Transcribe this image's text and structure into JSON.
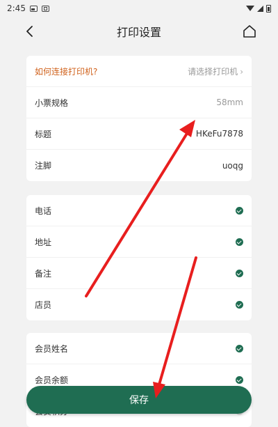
{
  "status_bar": {
    "time": "2:45"
  },
  "nav": {
    "title": "打印设置"
  },
  "card1": {
    "rows": [
      {
        "label": "如何连接打印机?",
        "value": "请选择打印机"
      },
      {
        "label": "小票规格",
        "value": "58mm"
      },
      {
        "label": "标题",
        "value": "HKeFu7878"
      },
      {
        "label": "注脚",
        "value": "uoqg"
      }
    ]
  },
  "card2": {
    "rows": [
      {
        "label": "电话",
        "checked": true
      },
      {
        "label": "地址",
        "checked": true
      },
      {
        "label": "备注",
        "checked": true
      },
      {
        "label": "店员",
        "checked": true
      }
    ]
  },
  "card3": {
    "rows": [
      {
        "label": "会员姓名",
        "checked": true
      },
      {
        "label": "会员余额",
        "checked": true
      },
      {
        "label": "会员积分",
        "checked": false
      }
    ]
  },
  "save_button": {
    "label": "保存"
  },
  "colors": {
    "accent": "#1f6d52",
    "link": "#d0621c",
    "annotation_arrow": "#e81e1e"
  },
  "icons": {
    "back": "back-arrow-icon",
    "home": "home-icon",
    "check": "check-circle-icon",
    "chevron": "chevron-right-icon"
  }
}
